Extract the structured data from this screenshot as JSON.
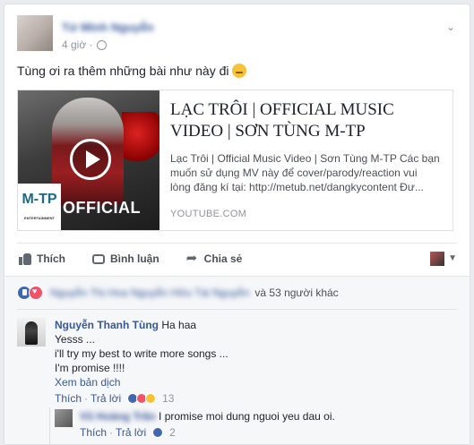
{
  "post": {
    "author_name": "Tứ Minh Nguyễn",
    "time": "4 giờ ·",
    "text": "Tùng ơi ra thêm những bài như này đi"
  },
  "link_preview": {
    "title": "LẠC TRÔI | OFFICIAL MUSIC VIDEO | SƠN TÙNG M-TP",
    "description": "Lạc Trôi | Official Music Video | Sơn Tùng M-TP Các bạn muốn sử dụng MV này để cover/parody/reaction vui lòng đăng kí tại: http://metub.net/dangkycontent Đư...",
    "domain": "YOUTUBE.COM",
    "thumb_logo": "M-TP",
    "thumb_logo_sub": "ENTERTAINMENT",
    "thumb_label": "OFFICIAL"
  },
  "actions": {
    "like": "Thích",
    "comment": "Bình luận",
    "share": "Chia sẻ"
  },
  "reactions_bar": {
    "names": "Nguyễn Thị Hoa Nguyễn Hữu Tài Nguyễn",
    "others": "và 53 người khác"
  },
  "comment": {
    "author": "Nguyễn Thanh Tùng",
    "first_line": "Ha haa",
    "lines": [
      "Yesss ...",
      "i'll try my best to write more songs ...",
      "I'm promise !!!!"
    ],
    "translate": "Xem bản dịch",
    "like": "Thích",
    "reply": "Trả lời",
    "reaction_count": "13"
  },
  "reply": {
    "author": "Vũ Hoàng Trần",
    "text": "I promise moi dung nguoi yeu dau oi.",
    "like": "Thích",
    "reply": "Trả lời",
    "reaction_count": "2"
  }
}
